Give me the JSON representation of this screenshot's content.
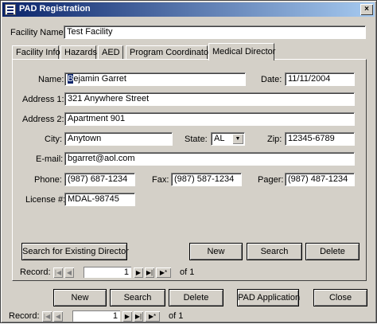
{
  "window": {
    "title": "PAD Registration",
    "close_icon": "×"
  },
  "facility": {
    "label": "Facility Name:",
    "value": "Test Facility"
  },
  "tabs": [
    {
      "label": "Facility Info"
    },
    {
      "label": "Hazards"
    },
    {
      "label": "AED"
    },
    {
      "label": "Program Coordinator"
    },
    {
      "label": "Medical Director"
    }
  ],
  "director": {
    "name_label": "Name:",
    "name_value": "Bejamin Garret",
    "name_cursor_char": "B",
    "name_rest": "ejamin Garret",
    "date_label": "Date:",
    "date_value": "11/11/2004",
    "address1_label": "Address 1:",
    "address1_value": "321 Anywhere Street",
    "address2_label": "Address 2:",
    "address2_value": "Apartment 901",
    "city_label": "City:",
    "city_value": "Anytown",
    "state_label": "State:",
    "state_value": "AL",
    "zip_label": "Zip:",
    "zip_value": "12345-6789",
    "email_label": "E-mail:",
    "email_value": "bgarret@aol.com",
    "phone_label": "Phone:",
    "phone_value": "(987) 687-1234",
    "fax_label": "Fax:",
    "fax_value": "(987) 587-1234",
    "pager_label": "Pager:",
    "pager_value": "(987) 487-1234",
    "license_label": "License #:",
    "license_value": "MDAL-98745"
  },
  "subform_buttons": {
    "search_existing": "Search for Existing Director",
    "new": "New",
    "search": "Search",
    "delete": "Delete"
  },
  "sub_record_nav": {
    "label": "Record:",
    "current": "1",
    "of_text": "of  1"
  },
  "main_buttons": {
    "new": "New",
    "search": "Search",
    "delete": "Delete",
    "pad_application": "PAD Application",
    "close": "Close"
  },
  "main_record_nav": {
    "label": "Record:",
    "current": "1",
    "of_text": "of  1"
  },
  "icons": {
    "first": "|◀",
    "prev": "◀",
    "next": "▶",
    "last": "▶|",
    "new": "▶*",
    "dropdown": "▼"
  }
}
